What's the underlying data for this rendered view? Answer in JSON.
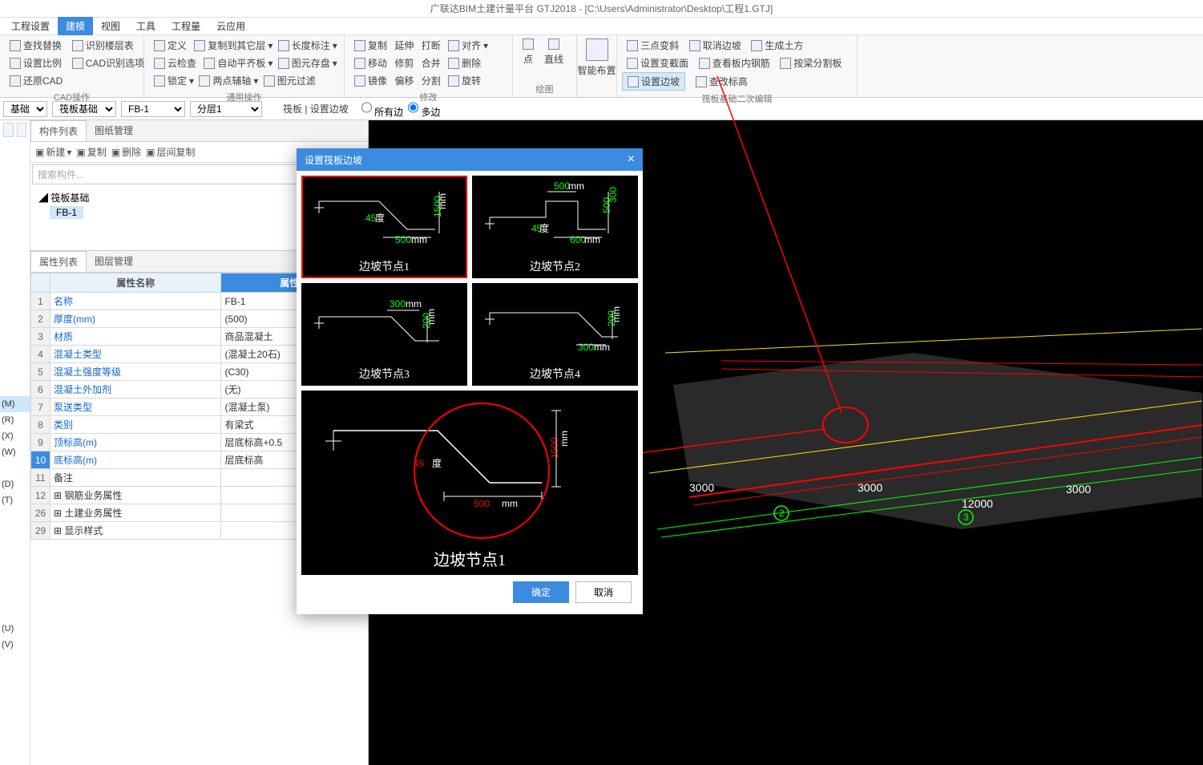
{
  "title": "广联达BIM土建计量平台 GTJ2018 - [C:\\Users\\Administrator\\Desktop\\工程1.GTJ]",
  "menus": [
    "工程设置",
    "建模",
    "视图",
    "工具",
    "工程量",
    "云应用"
  ],
  "activeMenu": 1,
  "ribbon": {
    "g1": {
      "items": [
        "查找替换",
        "识别楼层表",
        "定义",
        "复制到其它层",
        "长度标注"
      ],
      "title": ""
    },
    "g1b": {
      "items": [
        "设置比例",
        "CAD识别选项",
        "云检查",
        "自动平齐板",
        "图元存盘"
      ],
      "title": ""
    },
    "g1c": {
      "items": [
        "还原CAD",
        "锁定",
        "两点辅轴",
        "图元过滤"
      ],
      "title": "CAD操作"
    },
    "g2": {
      "title": "通用操作"
    },
    "g3": {
      "items": [
        "复制",
        "延伸",
        "打断",
        "对齐",
        "移动",
        "修剪",
        "合并",
        "删除",
        "镜像",
        "偏移",
        "分割",
        "旋转"
      ],
      "title": "修改"
    },
    "g4": {
      "items": [
        "点",
        "直线"
      ],
      "title": "绘图"
    },
    "g5": {
      "items": [
        "智能布置"
      ],
      "title": ""
    },
    "g6": {
      "items": [
        "三点变斜",
        "设置变截面",
        "设置边坡",
        "取消边坡",
        "查看板内钢筋",
        "查改标高",
        "生成土方",
        "按梁分割板"
      ],
      "title": "筏板基础二次编辑"
    }
  },
  "selrow": {
    "a": "基础",
    "b": "筏板基础",
    "c": "FB-1",
    "d": "分层1",
    "lbl": "筏板 | 设置边坡",
    "r1": "所有边",
    "r2": "多边"
  },
  "lefttree": [
    "(M)",
    "(R)",
    "(X)",
    "(W)",
    "",
    "(D)",
    "(T)",
    "",
    "",
    "",
    "",
    "",
    "",
    "(U)",
    "(V)"
  ],
  "tabs": {
    "t1": "构件列表",
    "t2": "图纸管理"
  },
  "tb2": {
    "a": "新建",
    "b": "复制",
    "c": "删除",
    "d": "层间复制"
  },
  "search": "搜索构件...",
  "tree": {
    "root": "筏板基础",
    "leaf": "FB-1"
  },
  "ptabs": {
    "a": "属性列表",
    "b": "图层管理"
  },
  "phdr": {
    "a": "属性名称",
    "b": "属性值"
  },
  "props": [
    {
      "n": "1",
      "k": "名称",
      "v": "FB-1"
    },
    {
      "n": "2",
      "k": "厚度(mm)",
      "v": "(500)"
    },
    {
      "n": "3",
      "k": "材质",
      "v": "商品混凝土"
    },
    {
      "n": "4",
      "k": "混凝土类型",
      "v": "(混凝土20石)"
    },
    {
      "n": "5",
      "k": "混凝土强度等级",
      "v": "(C30)"
    },
    {
      "n": "6",
      "k": "混凝土外加剂",
      "v": "(无)"
    },
    {
      "n": "7",
      "k": "泵送类型",
      "v": "(混凝土泵)"
    },
    {
      "n": "8",
      "k": "类别",
      "v": "有梁式"
    },
    {
      "n": "9",
      "k": "顶标高(m)",
      "v": "层底标高+0.5"
    },
    {
      "n": "10",
      "k": "底标高(m)",
      "v": "层底标高"
    },
    {
      "n": "11",
      "k": "备注",
      "v": ""
    },
    {
      "n": "12",
      "k": "钢筋业务属性",
      "v": ""
    },
    {
      "n": "26",
      "k": "土建业务属性",
      "v": ""
    },
    {
      "n": "29",
      "k": "显示样式",
      "v": ""
    }
  ],
  "dlg": {
    "title": "设置筏板边坡",
    "thumbs": [
      "边坡节点1",
      "边坡节点2",
      "边坡节点3",
      "边坡节点4"
    ],
    "big": "边坡节点1",
    "bigdims": {
      "ang": "45度",
      "w": "500 mm",
      "h": "1500 mm"
    },
    "t1": {
      "ang": "45度",
      "w": "500 mm",
      "h": "1500 mm"
    },
    "t2": {
      "ang": "45度",
      "w1": "500 mm",
      "w2": "600 mm",
      "h1": "500",
      "h2": "300"
    },
    "t3": {
      "w": "300 mm",
      "h": "200 mm"
    },
    "t4": {
      "w": "300 mm",
      "h": "200 mm"
    },
    "ok": "确定",
    "cancel": "取消"
  },
  "dims3d": {
    "a": "3000",
    "b": "3000",
    "c": "3000",
    "d": "12000",
    "n2": "2",
    "n3": "3"
  }
}
